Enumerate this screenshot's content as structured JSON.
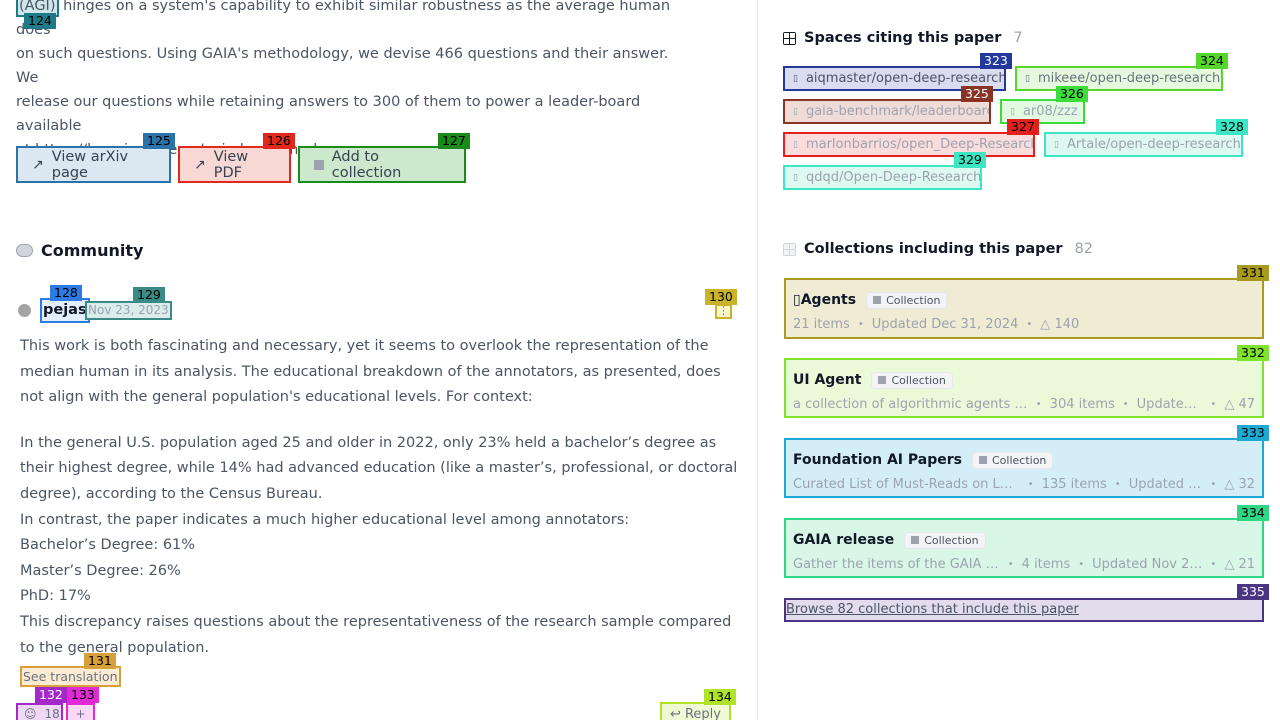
{
  "abstract": {
    "agi": "(AGI)",
    "line1_rest": " hinges on a system's capability to exhibit similar robustness as the average human does",
    "line2": "on such questions. Using GAIA's methodology, we devise 466 questions and their answer. We",
    "line3": "release our questions while retaining answers to 300 of them to power a leader-board available",
    "line4": "at https://huggingface.co/gaia-benchmark."
  },
  "actions": {
    "arxiv": "View arXiv page",
    "pdf": "View PDF",
    "collection": "Add to collection"
  },
  "community": {
    "title": "Community",
    "comment": {
      "user": "pejas",
      "date": "Nov 23, 2023",
      "para1": "This work is both fascinating and necessary, yet it seems to overlook the representation of the median human in its analysis. The educational breakdown of the annotators, as presented, does not align with the general population's educational levels. For context:",
      "para2": "In the general U.S. population aged 25 and older in 2022, only 23% held a bachelor’s degree as their highest degree, while 14% had advanced education (like a master’s, professional, or doctoral degree), according to the Census Bureau.",
      "para3": "In contrast, the paper indicates a much higher educational level among annotators:",
      "para4": "Bachelor’s Degree: 61%",
      "para5": "Master’s Degree: 26%",
      "para6": "PhD: 17%",
      "para7": "This discrepancy raises questions about the representativeness of the research sample compared to the general population.",
      "see_translation": "See translation",
      "reaction_count": "18",
      "add_reaction": "+",
      "reply": "Reply"
    }
  },
  "spaces": {
    "title": "Spaces citing this paper",
    "count": "7",
    "items": [
      "aiqmaster/open-deep-research",
      "mikeee/open-deep-research",
      "gaia-benchmark/leaderboard",
      "ar08/zzz",
      "marlonbarrios/open_Deep-Research",
      "Artale/open-deep-research",
      "qdqd/Open-Deep-Research"
    ]
  },
  "collections": {
    "title": "Collections including this paper",
    "count": "82",
    "badge": "Collection",
    "items": [
      {
        "title": "Agents",
        "desc": "",
        "items": "21 items",
        "updated": "Updated Dec 31, 2024",
        "likes": "140"
      },
      {
        "title": "UI Agent",
        "desc": "a collection of algorithmic agents for u...",
        "items": "304 items",
        "updated": "Updated ...",
        "likes": "47"
      },
      {
        "title": "Foundation AI Papers",
        "desc": "Curated List of Must-Reads on LLM re...",
        "items": "135 items",
        "updated": "Updated J...",
        "likes": "32"
      },
      {
        "title": "GAIA release",
        "desc": "Gather the items of the GAIA rel...",
        "items": "4 items",
        "updated": "Updated Nov 23, 2...",
        "likes": "21"
      }
    ],
    "browse": "Browse 82 collections that include this paper"
  },
  "tags": {
    "t124": "124",
    "t125": "125",
    "t126": "126",
    "t127": "127",
    "t128": "128",
    "t129": "129",
    "t130": "130",
    "t131": "131",
    "t132": "132",
    "t133": "133",
    "t134": "134",
    "t323": "323",
    "t324": "324",
    "t325": "325",
    "t326": "326",
    "t327": "327",
    "t328": "328",
    "t329": "329",
    "t331": "331",
    "t332": "332",
    "t333": "333",
    "t334": "334",
    "t335": "335"
  },
  "colors": {
    "accent_blue": "#2b72a8",
    "accent_red": "#e0281d",
    "accent_green": "#1a8a1a"
  }
}
